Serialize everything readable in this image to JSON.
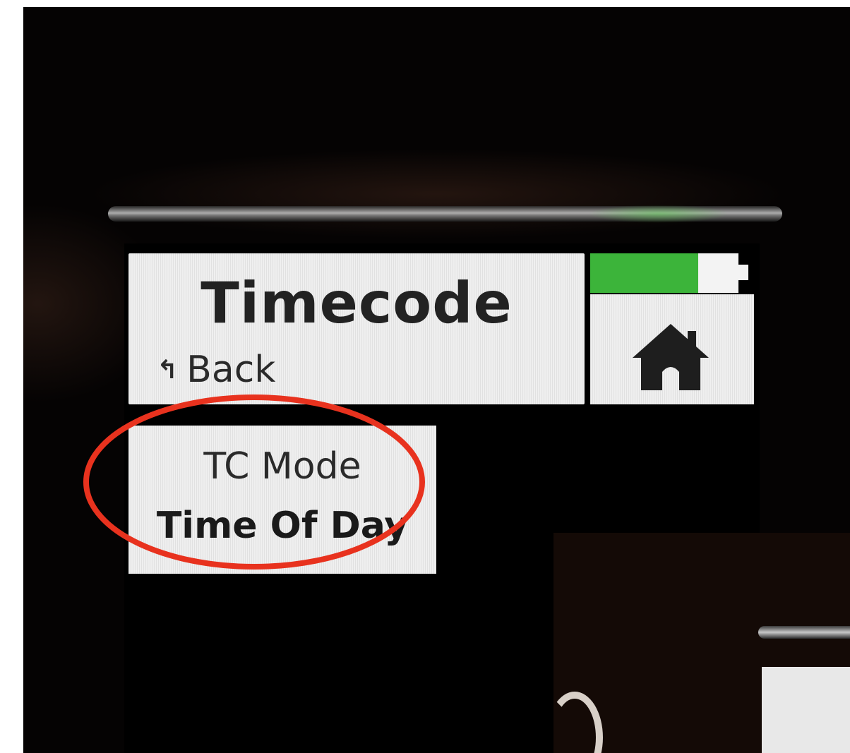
{
  "header": {
    "title": "Timecode",
    "back_label": "Back",
    "back_icon": "return-arrow-icon",
    "home_icon": "home-icon"
  },
  "status": {
    "battery_level": 0.73,
    "battery_color": "#3cb43a"
  },
  "menu": {
    "items": [
      {
        "label": "TC Mode",
        "value": "Time Of Day"
      }
    ]
  },
  "annotation": {
    "shape": "ellipse",
    "color": "#e8321e"
  }
}
